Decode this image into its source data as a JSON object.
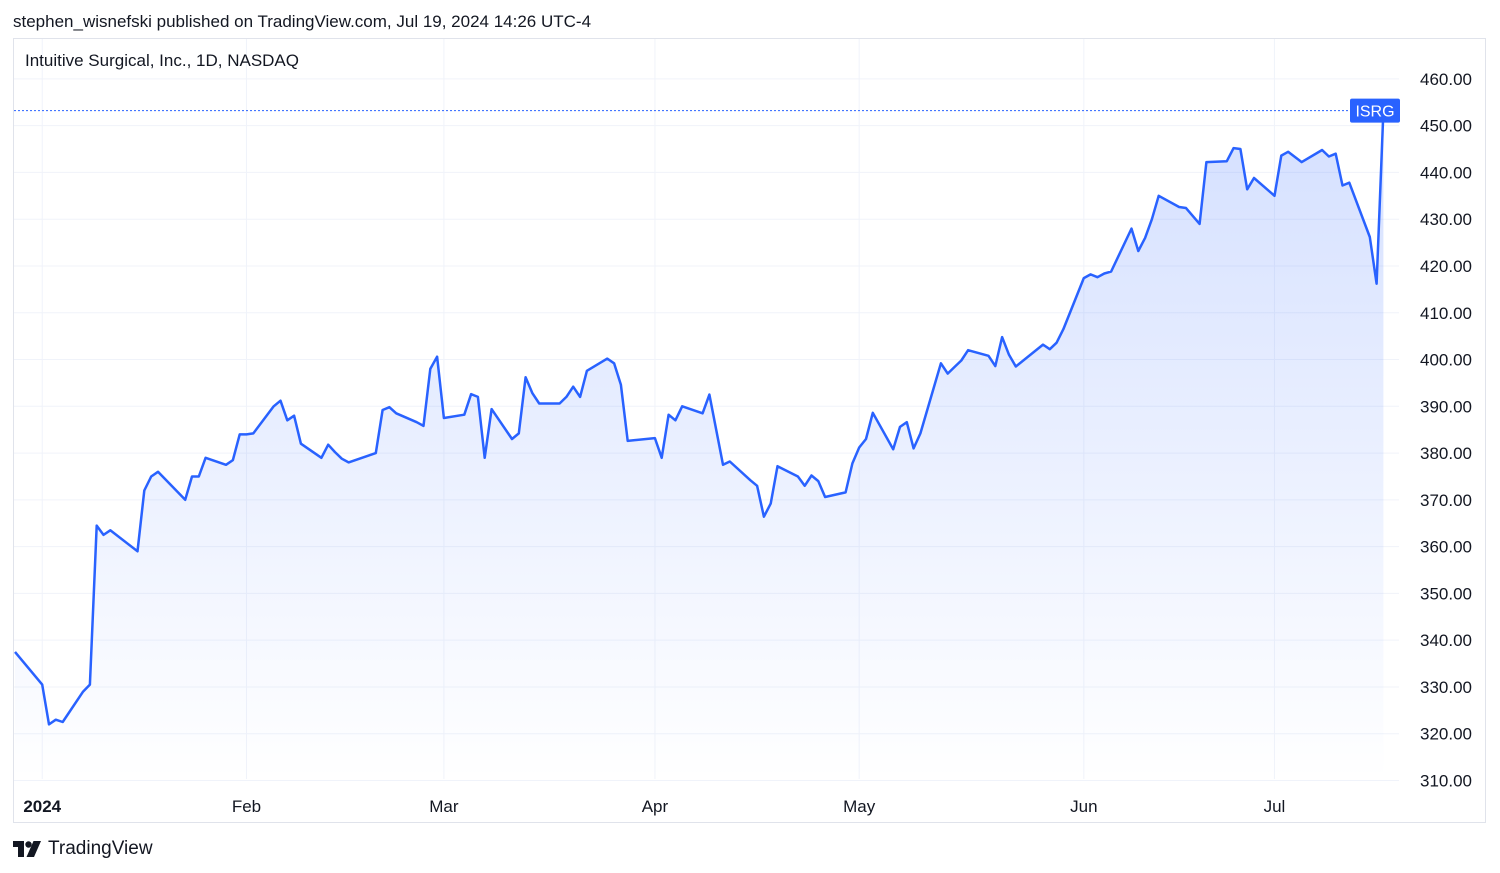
{
  "header": {
    "published_line": "stephen_wisnefski published on TradingView.com, Jul 19, 2024 14:26 UTC-4"
  },
  "footer": {
    "brand": "TradingView"
  },
  "colors": {
    "line": "#2962ff",
    "fill_top": "#2962ff",
    "grid": "#f0f3fa",
    "axis_text": "#131722",
    "badge": "#2962ff"
  },
  "chart_data": {
    "type": "area",
    "title": "Intuitive Surgical, Inc., 1D, NASDAQ",
    "series": [
      {
        "name": "ISRG",
        "dates": [
          "2023-12-29",
          "2024-01-02",
          "2024-01-03",
          "2024-01-04",
          "2024-01-05",
          "2024-01-08",
          "2024-01-09",
          "2024-01-10",
          "2024-01-11",
          "2024-01-12",
          "2024-01-16",
          "2024-01-17",
          "2024-01-18",
          "2024-01-19",
          "2024-01-22",
          "2024-01-23",
          "2024-01-24",
          "2024-01-25",
          "2024-01-26",
          "2024-01-29",
          "2024-01-30",
          "2024-01-31",
          "2024-02-01",
          "2024-02-02",
          "2024-02-05",
          "2024-02-06",
          "2024-02-07",
          "2024-02-08",
          "2024-02-09",
          "2024-02-12",
          "2024-02-13",
          "2024-02-14",
          "2024-02-15",
          "2024-02-16",
          "2024-02-20",
          "2024-02-21",
          "2024-02-22",
          "2024-02-23",
          "2024-02-26",
          "2024-02-27",
          "2024-02-28",
          "2024-02-29",
          "2024-03-01",
          "2024-03-04",
          "2024-03-05",
          "2024-03-06",
          "2024-03-07",
          "2024-03-08",
          "2024-03-11",
          "2024-03-12",
          "2024-03-13",
          "2024-03-14",
          "2024-03-15",
          "2024-03-18",
          "2024-03-19",
          "2024-03-20",
          "2024-03-21",
          "2024-03-22",
          "2024-03-25",
          "2024-03-26",
          "2024-03-27",
          "2024-03-28",
          "2024-04-01",
          "2024-04-02",
          "2024-04-03",
          "2024-04-04",
          "2024-04-05",
          "2024-04-08",
          "2024-04-09",
          "2024-04-10",
          "2024-04-11",
          "2024-04-12",
          "2024-04-15",
          "2024-04-16",
          "2024-04-17",
          "2024-04-18",
          "2024-04-19",
          "2024-04-22",
          "2024-04-23",
          "2024-04-24",
          "2024-04-25",
          "2024-04-26",
          "2024-04-29",
          "2024-04-30",
          "2024-05-01",
          "2024-05-02",
          "2024-05-03",
          "2024-05-06",
          "2024-05-07",
          "2024-05-08",
          "2024-05-09",
          "2024-05-10",
          "2024-05-13",
          "2024-05-14",
          "2024-05-15",
          "2024-05-16",
          "2024-05-17",
          "2024-05-20",
          "2024-05-21",
          "2024-05-22",
          "2024-05-23",
          "2024-05-24",
          "2024-05-28",
          "2024-05-29",
          "2024-05-30",
          "2024-05-31",
          "2024-06-03",
          "2024-06-04",
          "2024-06-05",
          "2024-06-06",
          "2024-06-07",
          "2024-06-10",
          "2024-06-11",
          "2024-06-12",
          "2024-06-13",
          "2024-06-14",
          "2024-06-17",
          "2024-06-18",
          "2024-06-20",
          "2024-06-21",
          "2024-06-24",
          "2024-06-25",
          "2024-06-26",
          "2024-06-27",
          "2024-06-28",
          "2024-07-01",
          "2024-07-02",
          "2024-07-03",
          "2024-07-05",
          "2024-07-08",
          "2024-07-09",
          "2024-07-10",
          "2024-07-11",
          "2024-07-12",
          "2024-07-15",
          "2024-07-16",
          "2024-07-17",
          "2024-07-18",
          "2024-07-19"
        ],
        "values": [
          337.5,
          330.5,
          322.0,
          323.0,
          322.5,
          329.0,
          330.5,
          364.5,
          362.5,
          363.5,
          359.0,
          372.0,
          375.0,
          376.0,
          371.5,
          370.0,
          375.0,
          375.0,
          379.0,
          377.5,
          378.5,
          384.0,
          384.0,
          384.2,
          390.0,
          391.2,
          387.0,
          388.0,
          382.0,
          379.0,
          381.8,
          380.2,
          378.8,
          378.0,
          380.0,
          389.2,
          389.8,
          388.5,
          386.6,
          385.8,
          398.0,
          400.6,
          387.5,
          388.2,
          392.6,
          392.0,
          379.0,
          389.4,
          383.0,
          384.2,
          396.2,
          392.8,
          390.6,
          390.6,
          392.0,
          394.2,
          392.0,
          397.6,
          400.2,
          399.2,
          394.6,
          382.6,
          383.2,
          379.0,
          388.2,
          387.0,
          390.0,
          388.5,
          392.5,
          385.0,
          377.5,
          378.2,
          374.2,
          373.0,
          366.4,
          369.2,
          377.2,
          375.0,
          373.0,
          375.2,
          374.0,
          370.6,
          371.6,
          377.8,
          381.2,
          383.0,
          388.6,
          380.8,
          385.6,
          386.6,
          381.0,
          384.2,
          399.2,
          397.0,
          398.4,
          399.8,
          402.0,
          400.8,
          398.6,
          404.8,
          401.0,
          398.5,
          403.2,
          402.2,
          403.6,
          406.5,
          417.4,
          418.2,
          417.6,
          418.4,
          418.8,
          428.0,
          423.2,
          426.0,
          430.0,
          435.0,
          432.6,
          432.4,
          429.0,
          442.2,
          442.4,
          445.2,
          445.0,
          436.4,
          438.8,
          435.0,
          443.6,
          444.4,
          442.2,
          444.8,
          443.4,
          444.0,
          437.2,
          437.8,
          426.2,
          416.2,
          453.2
        ]
      }
    ],
    "last_value_label": "ISRG",
    "ylim": [
      310,
      465
    ],
    "y_ticks": [
      310,
      320,
      330,
      340,
      350,
      360,
      370,
      380,
      390,
      400,
      410,
      420,
      430,
      440,
      450,
      460
    ],
    "y_tick_labels": [
      "310.00",
      "320.00",
      "330.00",
      "340.00",
      "350.00",
      "360.00",
      "370.00",
      "380.00",
      "390.00",
      "400.00",
      "410.00",
      "420.00",
      "430.00",
      "440.00",
      "450.00",
      "460.00"
    ],
    "x_ticks": [
      {
        "date": "2024-01-02",
        "label": "2024"
      },
      {
        "date": "2024-02-01",
        "label": "Feb"
      },
      {
        "date": "2024-03-01",
        "label": "Mar"
      },
      {
        "date": "2024-04-01",
        "label": "Apr"
      },
      {
        "date": "2024-05-01",
        "label": "May"
      },
      {
        "date": "2024-06-03",
        "label": "Jun"
      },
      {
        "date": "2024-07-01",
        "label": "Jul"
      }
    ],
    "grid": true,
    "price_line": true,
    "price_scale_position": "right"
  }
}
